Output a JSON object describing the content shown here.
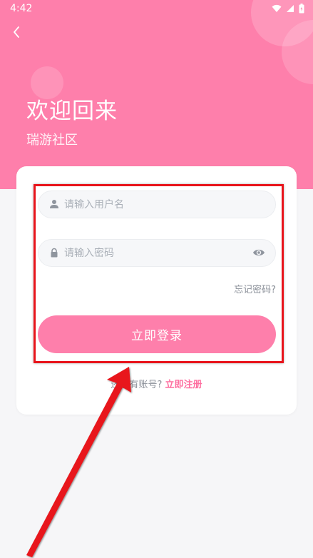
{
  "status_bar": {
    "time": "4:42"
  },
  "header": {
    "title": "欢迎回来",
    "subtitle": "瑞游社区"
  },
  "form": {
    "username_placeholder": "请输入用户名",
    "password_placeholder": "请输入密码",
    "forgot_label": "忘记密码?",
    "login_label": "立即登录"
  },
  "footer": {
    "prompt": "还没有账号?",
    "register_label": "立即注册"
  },
  "colors": {
    "brand": "#fe7fab",
    "link": "#fe6fa0",
    "annotation": "#e8141b"
  }
}
